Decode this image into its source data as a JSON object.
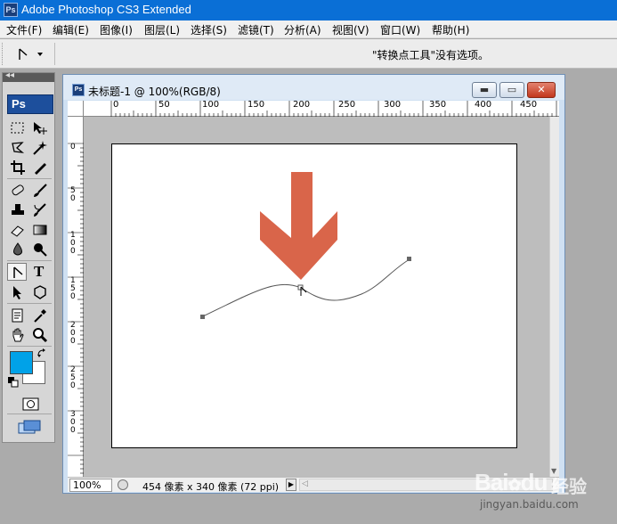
{
  "app": {
    "title": "Adobe Photoshop CS3 Extended",
    "icon_text": "Ps"
  },
  "menu": [
    {
      "label": "文件(F)"
    },
    {
      "label": "编辑(E)"
    },
    {
      "label": "图像(I)"
    },
    {
      "label": "图层(L)"
    },
    {
      "label": "选择(S)"
    },
    {
      "label": "滤镜(T)"
    },
    {
      "label": "分析(A)"
    },
    {
      "label": "视图(V)"
    },
    {
      "label": "窗口(W)"
    },
    {
      "label": "帮助(H)"
    }
  ],
  "options_bar": {
    "message": "\"转换点工具\"没有选项。",
    "active_tool_icon": "convert-point-arrow-icon"
  },
  "toolbox": {
    "badge": "Ps",
    "collapse_glyph": "◂◂",
    "foreground_color": "#00a2e8",
    "background_color": "#ffffff",
    "tools": [
      {
        "name": "rectangular-marquee-icon"
      },
      {
        "name": "move-icon"
      },
      {
        "name": "lasso-icon"
      },
      {
        "name": "magic-wand-icon"
      },
      {
        "name": "crop-icon"
      },
      {
        "name": "slice-icon"
      },
      {
        "name": "healing-brush-icon"
      },
      {
        "name": "brush-icon"
      },
      {
        "name": "clone-stamp-icon"
      },
      {
        "name": "history-brush-icon"
      },
      {
        "name": "eraser-icon"
      },
      {
        "name": "gradient-icon"
      },
      {
        "name": "blur-icon"
      },
      {
        "name": "dodge-icon"
      },
      {
        "name": "pen-convert-point-icon",
        "active": true
      },
      {
        "name": "type-icon"
      },
      {
        "name": "path-selection-icon"
      },
      {
        "name": "shape-icon"
      },
      {
        "name": "notes-icon"
      },
      {
        "name": "eyedropper-icon"
      },
      {
        "name": "hand-icon"
      },
      {
        "name": "zoom-icon"
      }
    ],
    "type_glyph": "T"
  },
  "document": {
    "title": "未标题-1 @ 100%(RGB/8)",
    "icon_text": "Ps",
    "minimize": "▬",
    "maximize": "▭",
    "close": "✕",
    "ruler_h_labels": [
      "0",
      "50",
      "100",
      "150",
      "200",
      "250",
      "300",
      "350",
      "400",
      "450"
    ],
    "ruler_v_labels": [
      "0",
      "5\n0",
      "1\n0\n0",
      "1\n5\n0",
      "2\n0\n0",
      "2\n5\n0",
      "3\n0\n0"
    ],
    "arrow_color": "#d9654a",
    "path_color": "#555555",
    "zoom": "100%",
    "info": "454 像素 x 340 像素 (72 ppi)",
    "next_glyph": "▶",
    "scroll_left_glyph": "◁",
    "scroll_down_glyph": "▼"
  },
  "watermark": {
    "brand": "Bai",
    "brand_suffix": "du",
    "cn": "经验",
    "url": "jingyan.baidu.com"
  }
}
